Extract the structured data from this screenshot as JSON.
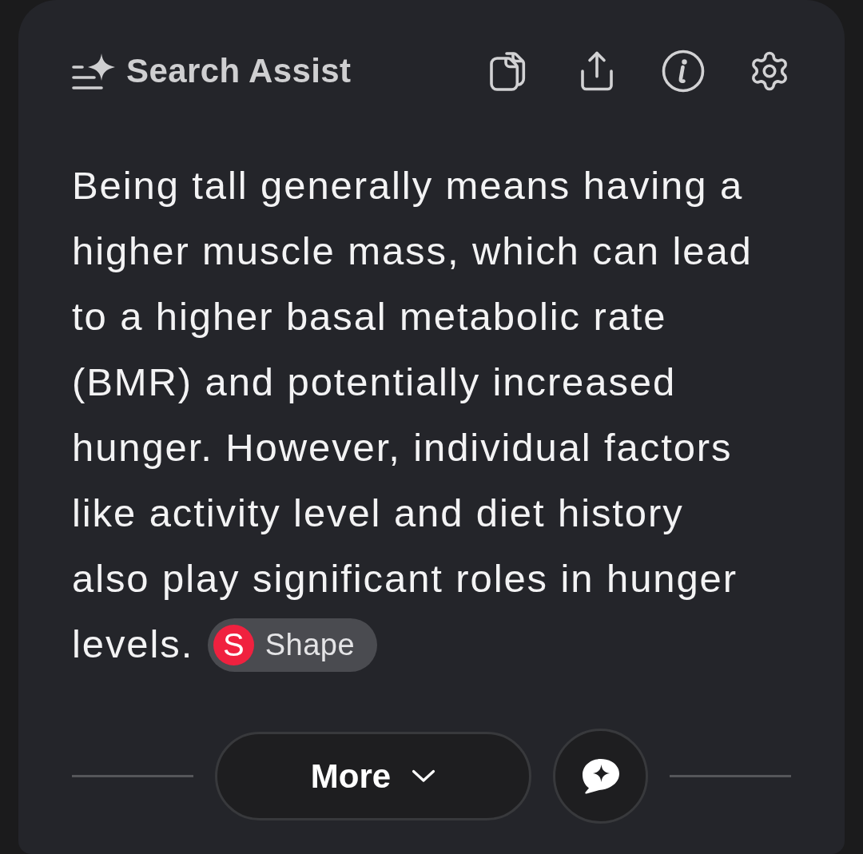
{
  "header": {
    "title": "Search Assist"
  },
  "answer": {
    "text": "Being tall generally means having a higher muscle mass, which can lead to a higher basal metabolic rate (BMR) and potentially increased hunger. However, individual factors like activity level and diet history also play significant roles in hunger levels.",
    "source": {
      "logo_letter": "S",
      "label": "Shape"
    }
  },
  "footer": {
    "more_button": {
      "label": "More",
      "expanded": false
    }
  }
}
